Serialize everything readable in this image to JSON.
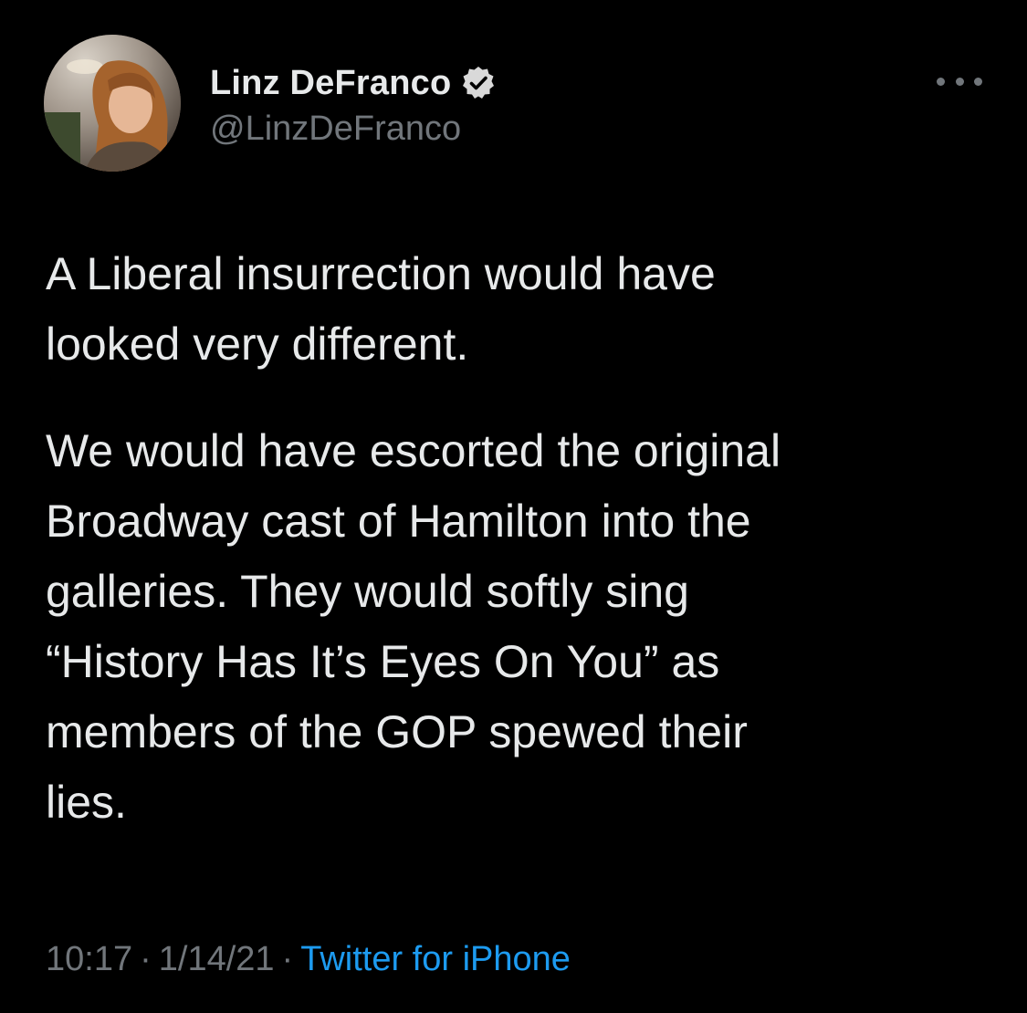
{
  "author": {
    "display_name": "Linz DeFranco",
    "handle": "@LinzDeFranco",
    "verified": true,
    "avatar_icon": "profile-photo"
  },
  "tweet": {
    "paragraph_1": "A Liberal insurrection would have\nlooked very different.",
    "paragraph_2": "We would have escorted the original\nBroadway cast of Hamilton into the\ngalleries. They would softly sing\n“History Has It’s Eyes On You” as\nmembers of the GOP spewed their\nlies."
  },
  "meta": {
    "time": "10:17",
    "separator": "·",
    "date": "1/14/21",
    "source": "Twitter for iPhone"
  },
  "colors": {
    "background": "#000000",
    "text": "#e7e9ea",
    "secondary": "#71767b",
    "link": "#1d9bf0"
  },
  "icons": {
    "more": "more-horizontal-icon",
    "verified": "verified-badge-icon"
  }
}
